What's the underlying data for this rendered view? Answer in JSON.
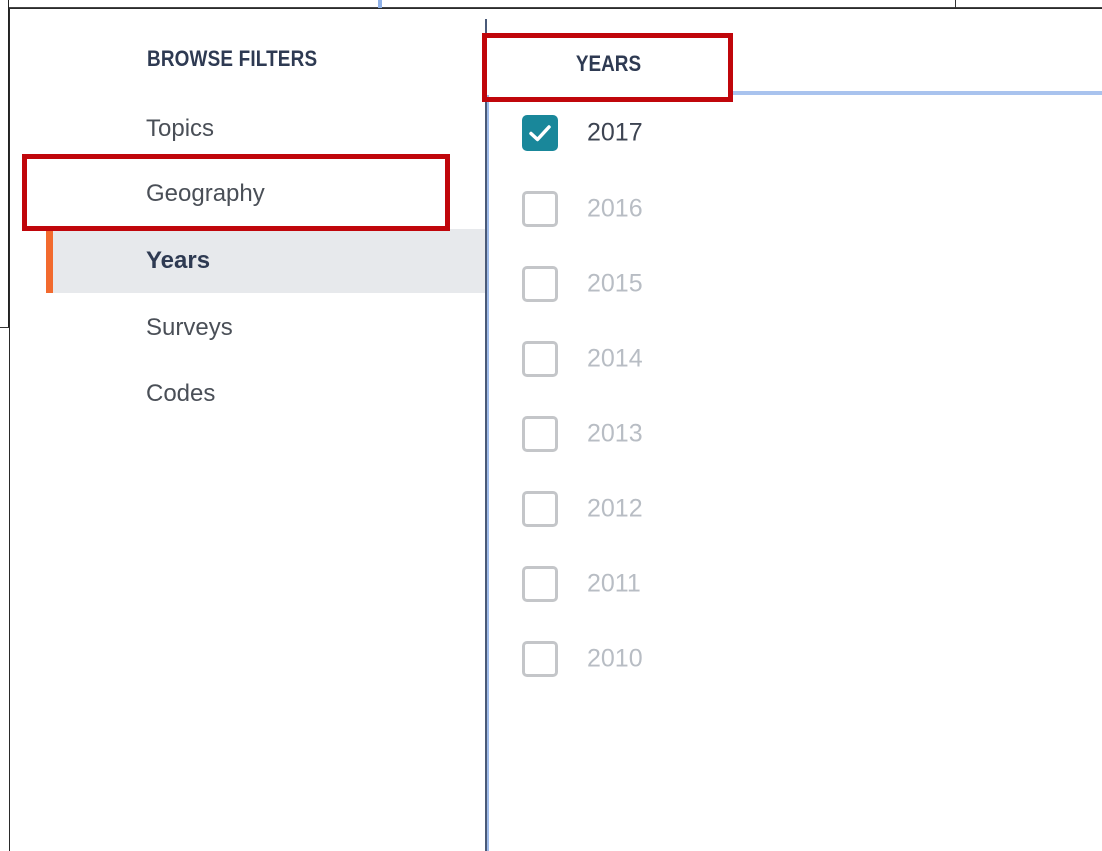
{
  "sidebar": {
    "title": "BROWSE FILTERS",
    "items": [
      {
        "label": "Topics",
        "active": false
      },
      {
        "label": "Geography",
        "active": false
      },
      {
        "label": "Years",
        "active": true
      },
      {
        "label": "Surveys",
        "active": false
      },
      {
        "label": "Codes",
        "active": false
      }
    ]
  },
  "content": {
    "tab_label": "YEARS",
    "years": [
      {
        "label": "2017",
        "checked": true
      },
      {
        "label": "2016",
        "checked": false
      },
      {
        "label": "2015",
        "checked": false
      },
      {
        "label": "2014",
        "checked": false
      },
      {
        "label": "2013",
        "checked": false
      },
      {
        "label": "2012",
        "checked": false
      },
      {
        "label": "2011",
        "checked": false
      },
      {
        "label": "2010",
        "checked": false
      }
    ]
  },
  "colors": {
    "accent_orange": "#f26a2e",
    "checkbox_checked": "#19879a",
    "highlight_red": "#c0060b",
    "tab_underline": "#a9c3ee",
    "heading_text": "#2e3a52"
  },
  "icons": {
    "checkmark": "check-icon"
  }
}
